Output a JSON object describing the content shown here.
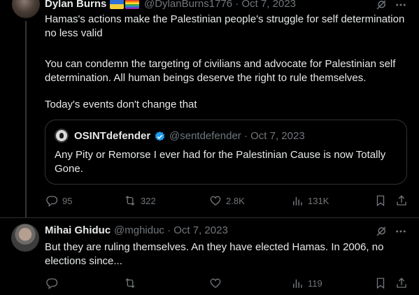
{
  "tweet1": {
    "display_name": "Dylan Burns",
    "flags": [
      "ukraine-flag",
      "pride-flag"
    ],
    "handle_meta": "@DylanBurns1776 · Oct 7, 2023",
    "paragraphs": [
      "Hamas's actions make the Palestinian people's struggle for self determination no less valid",
      "You can condemn the targeting of civilians and advocate for Palestinian self determination. All human beings deserve the right to rule themselves.",
      "Today's events don't change that"
    ],
    "quote": {
      "display_name": "OSINTdefender",
      "handle_meta": "@sentdefender · Oct 7, 2023",
      "text": "Any Pity or Remorse I ever had for the Palestinian Cause is now Totally Gone."
    },
    "actions": {
      "replies": "95",
      "retweets": "322",
      "likes": "2.8K",
      "views": "131K"
    }
  },
  "tweet2": {
    "display_name": "Mihai Ghiduc",
    "handle_meta": "@mghiduc · Oct 7, 2023",
    "text": "But they are ruling themselves. An they have elected Hamas. In 2006, no elections since...",
    "actions": {
      "replies": "",
      "retweets": "",
      "likes": "",
      "views": "119"
    }
  },
  "colors": {
    "background": "#000000",
    "text": "#e7e9ea",
    "muted": "#71767b",
    "border": "#2f3336",
    "verified": "#1d9bf0"
  }
}
